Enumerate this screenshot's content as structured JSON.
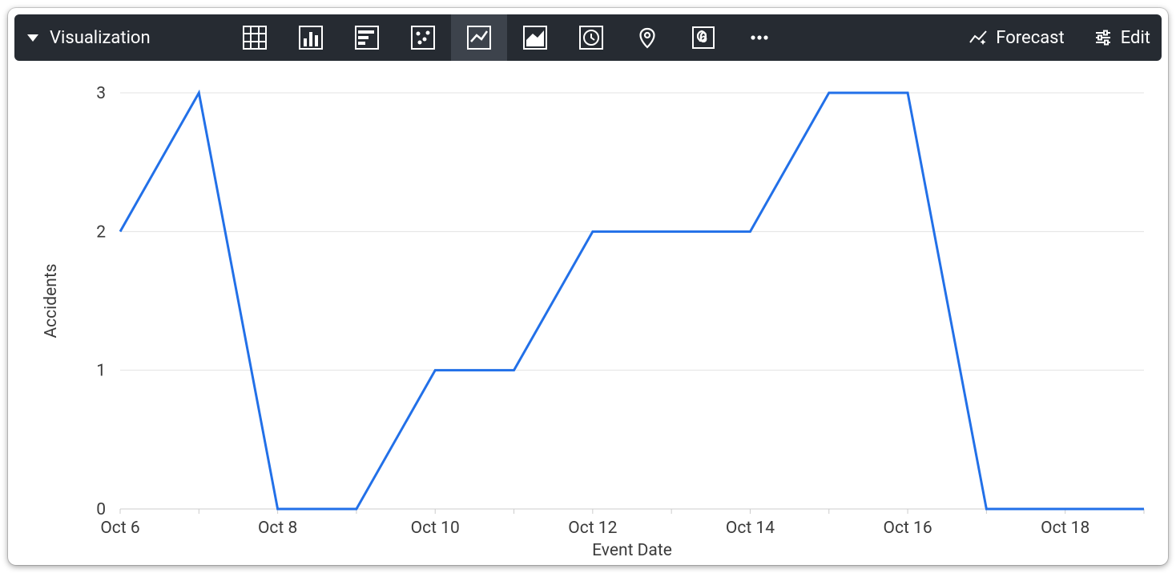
{
  "toolbar": {
    "title": "Visualization",
    "forecast_label": "Forecast",
    "edit_label": "Edit",
    "viz_types": [
      {
        "id": "table",
        "selected": false
      },
      {
        "id": "column",
        "selected": false
      },
      {
        "id": "bar",
        "selected": false
      },
      {
        "id": "scatter",
        "selected": false
      },
      {
        "id": "line",
        "selected": true
      },
      {
        "id": "area",
        "selected": false
      },
      {
        "id": "timeline",
        "selected": false
      },
      {
        "id": "map",
        "selected": false
      },
      {
        "id": "single",
        "selected": false
      },
      {
        "id": "more",
        "selected": false
      }
    ]
  },
  "chart_data": {
    "type": "line",
    "xlabel": "Event Date",
    "ylabel": "Accidents",
    "ylim": [
      0,
      3
    ],
    "yticks": [
      0,
      1,
      2,
      3
    ],
    "categories": [
      "Oct 6",
      "Oct 7",
      "Oct 8",
      "Oct 9",
      "Oct 10",
      "Oct 11",
      "Oct 12",
      "Oct 13",
      "Oct 14",
      "Oct 15",
      "Oct 16",
      "Oct 17",
      "Oct 18",
      "Oct 19"
    ],
    "x_tick_labels": [
      "Oct 6",
      "Oct 8",
      "Oct 10",
      "Oct 12",
      "Oct 14",
      "Oct 16",
      "Oct 18"
    ],
    "values": [
      2,
      3,
      0,
      0,
      1,
      1,
      2,
      2,
      2,
      3,
      3,
      0,
      0,
      0
    ]
  }
}
